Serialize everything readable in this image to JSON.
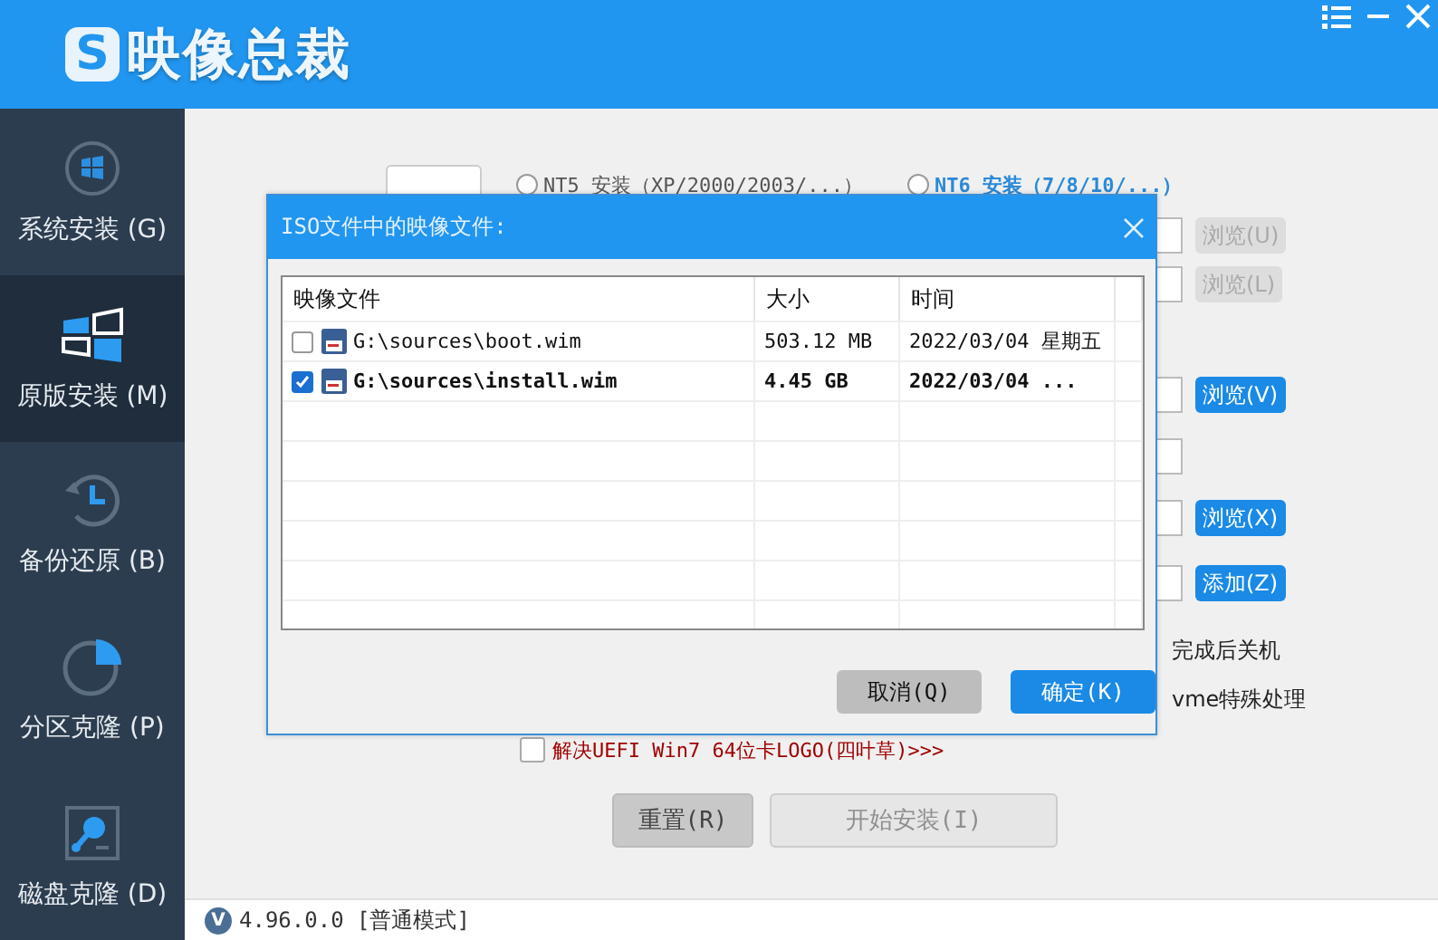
{
  "app": {
    "logo_letter": "S",
    "title": "映像总裁"
  },
  "sidebar": {
    "items": [
      {
        "kind": "system",
        "label": "系统安装 (G)",
        "selected": false
      },
      {
        "kind": "original",
        "label": "原版安装 (M)",
        "selected": true
      },
      {
        "kind": "backup",
        "label": "备份还原 (B)",
        "selected": false
      },
      {
        "kind": "partition",
        "label": "分区克隆 (P)",
        "selected": false
      },
      {
        "kind": "disk",
        "label": "磁盘克隆 (D)",
        "selected": false
      }
    ]
  },
  "modes": [
    {
      "label": "NT5 安装（XP/2000/2003/...）",
      "selected": false,
      "emphasized": false
    },
    {
      "label": "NT6 安装（7/8/10/...）",
      "selected": false,
      "emphasized": true
    }
  ],
  "side_rows": [
    {
      "kind": "browse",
      "button": "浏览(U)",
      "disabled": true
    },
    {
      "kind": "browse",
      "button": "浏览(L)",
      "disabled": true
    },
    {
      "kind": "browse",
      "button": "浏览(V)",
      "disabled": false
    },
    {
      "kind": "field"
    },
    {
      "kind": "browse",
      "button": "浏览(X)",
      "disabled": false
    },
    {
      "kind": "browse",
      "button": "添加(Z)",
      "disabled": false
    },
    {
      "kind": "option",
      "label": "完成后关机"
    },
    {
      "kind": "option",
      "label": "vme特殊处理"
    }
  ],
  "uefi_fix": {
    "label": "解决UEFI Win7 64位卡LOGO(四叶草)>>>",
    "checked": false
  },
  "buttons": [
    {
      "label": "重置(R)",
      "disabled": false
    },
    {
      "label": "开始安装(I)",
      "disabled": true
    }
  ],
  "dialog": {
    "title": "ISO文件中的映像文件:",
    "columns": [
      "映像文件",
      "大小",
      "时间"
    ],
    "rows": [
      {
        "checked": false,
        "file": "G:\\sources\\boot.wim",
        "size": "503.12 MB",
        "time": "2022/03/04 星期五"
      },
      {
        "checked": true,
        "file": "G:\\sources\\install.wim",
        "size": "4.45 GB",
        "time": "2022/03/04 ..."
      }
    ],
    "buttons": [
      {
        "kind": "cancel",
        "label": "取消(Q)"
      },
      {
        "kind": "ok",
        "label": "确定(K)"
      }
    ]
  },
  "status": {
    "badge": "V",
    "text": "4.96.0.0 [普通模式]"
  }
}
